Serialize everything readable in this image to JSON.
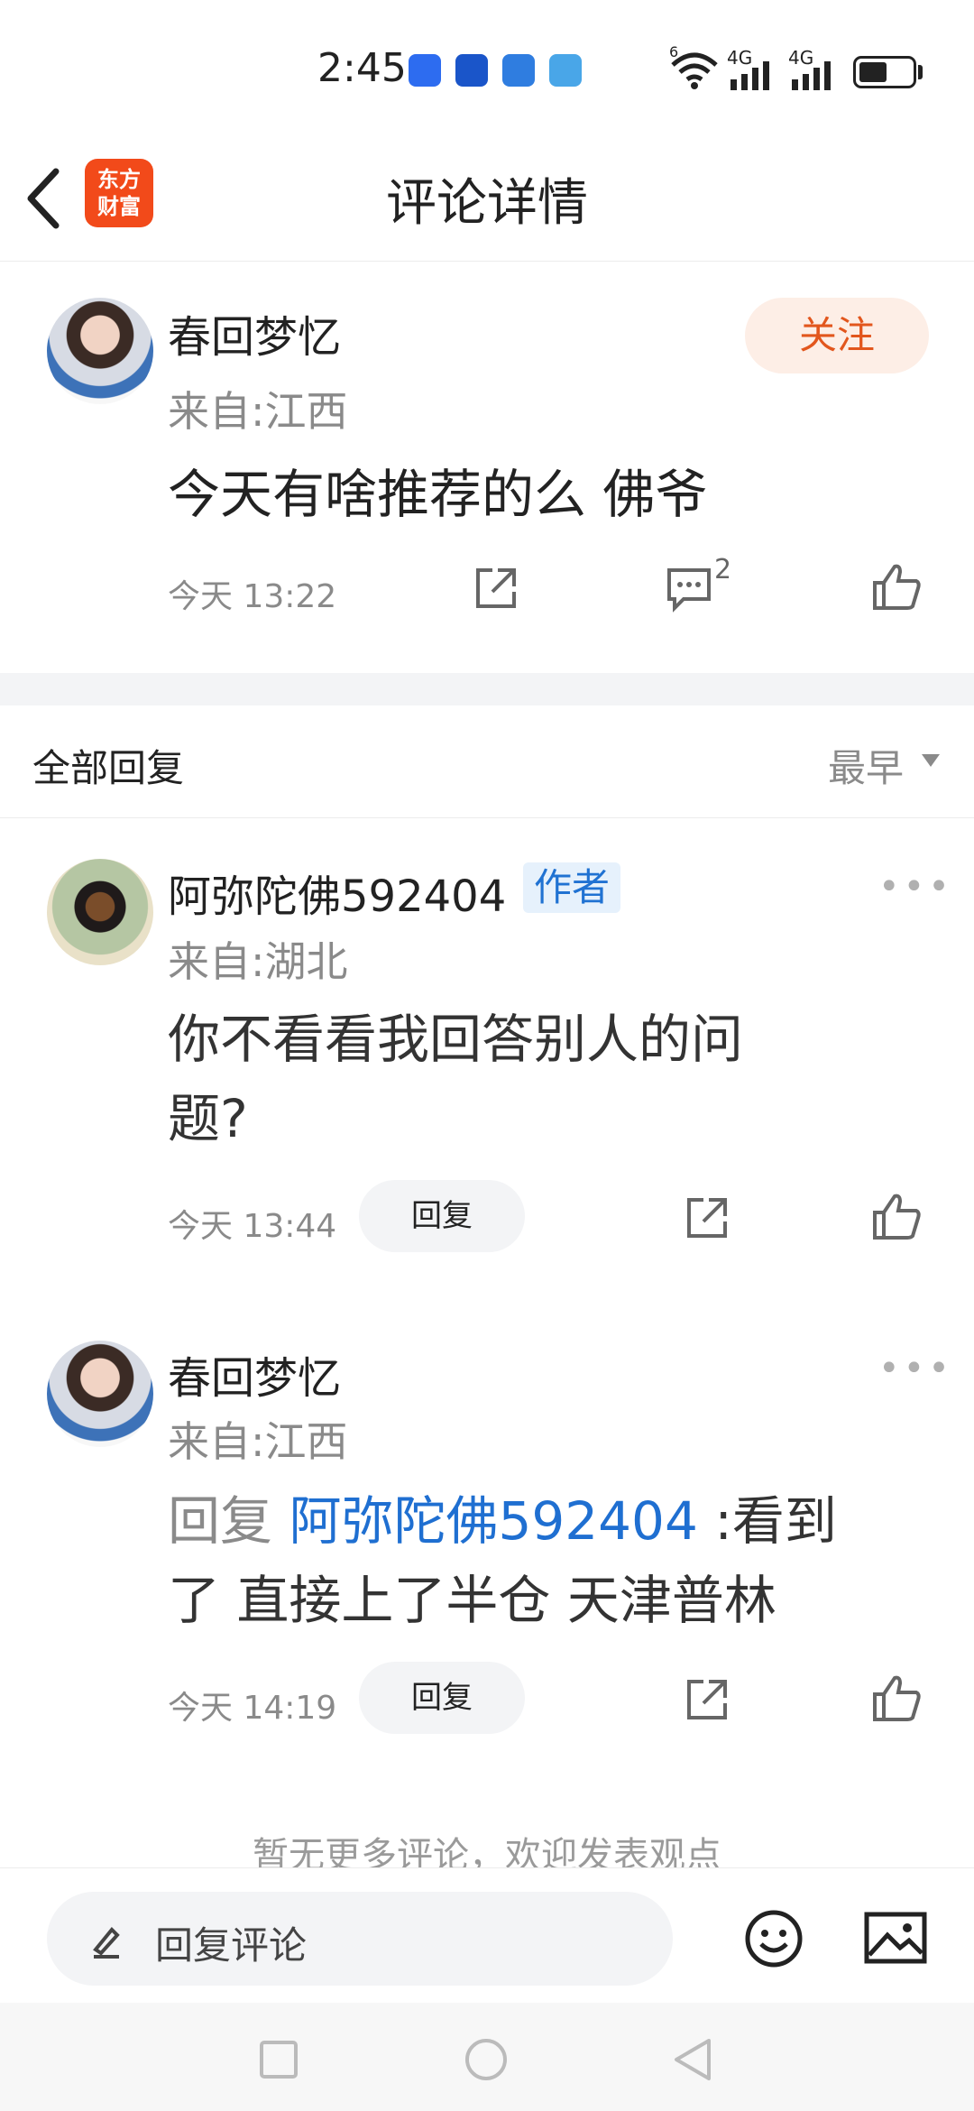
{
  "status_bar": {
    "time": "2:45",
    "signal_1": "4G",
    "signal_2": "4G",
    "wifi_badge": "6"
  },
  "header": {
    "title": "评论详情",
    "logo_line1": "东方",
    "logo_line2": "财富"
  },
  "main_comment": {
    "author": "春回梦忆",
    "location": "来自:江西",
    "follow_label": "关注",
    "content": "今天有啥推荐的么 佛爷",
    "time": "今天 13:22",
    "comment_count": "2"
  },
  "replies_header": {
    "title": "全部回复",
    "sort_label": "最早"
  },
  "replies": [
    {
      "author": "阿弥陀佛592404",
      "badge": "作者",
      "location": "来自:湖北",
      "content_line1": "你不看看我回答别人的问",
      "content_line2": "题?",
      "time": "今天 13:44",
      "reply_label": "回复"
    },
    {
      "author": "春回梦忆",
      "location": "来自:江西",
      "reply_prefix": "回复",
      "reply_target": "阿弥陀佛592404",
      "content_line1_rest": ":看到",
      "content_line2": "了 直接上了半仓 天津普林",
      "time": "今天 14:19",
      "reply_label": "回复"
    }
  ],
  "end_tip": "暂无更多评论，欢迎发表观点",
  "bottom_bar": {
    "input_placeholder": "回复评论"
  },
  "colors": {
    "accent_orange": "#e2561d",
    "link_blue": "#1f6fd1",
    "logo_red": "#f24a1a"
  }
}
